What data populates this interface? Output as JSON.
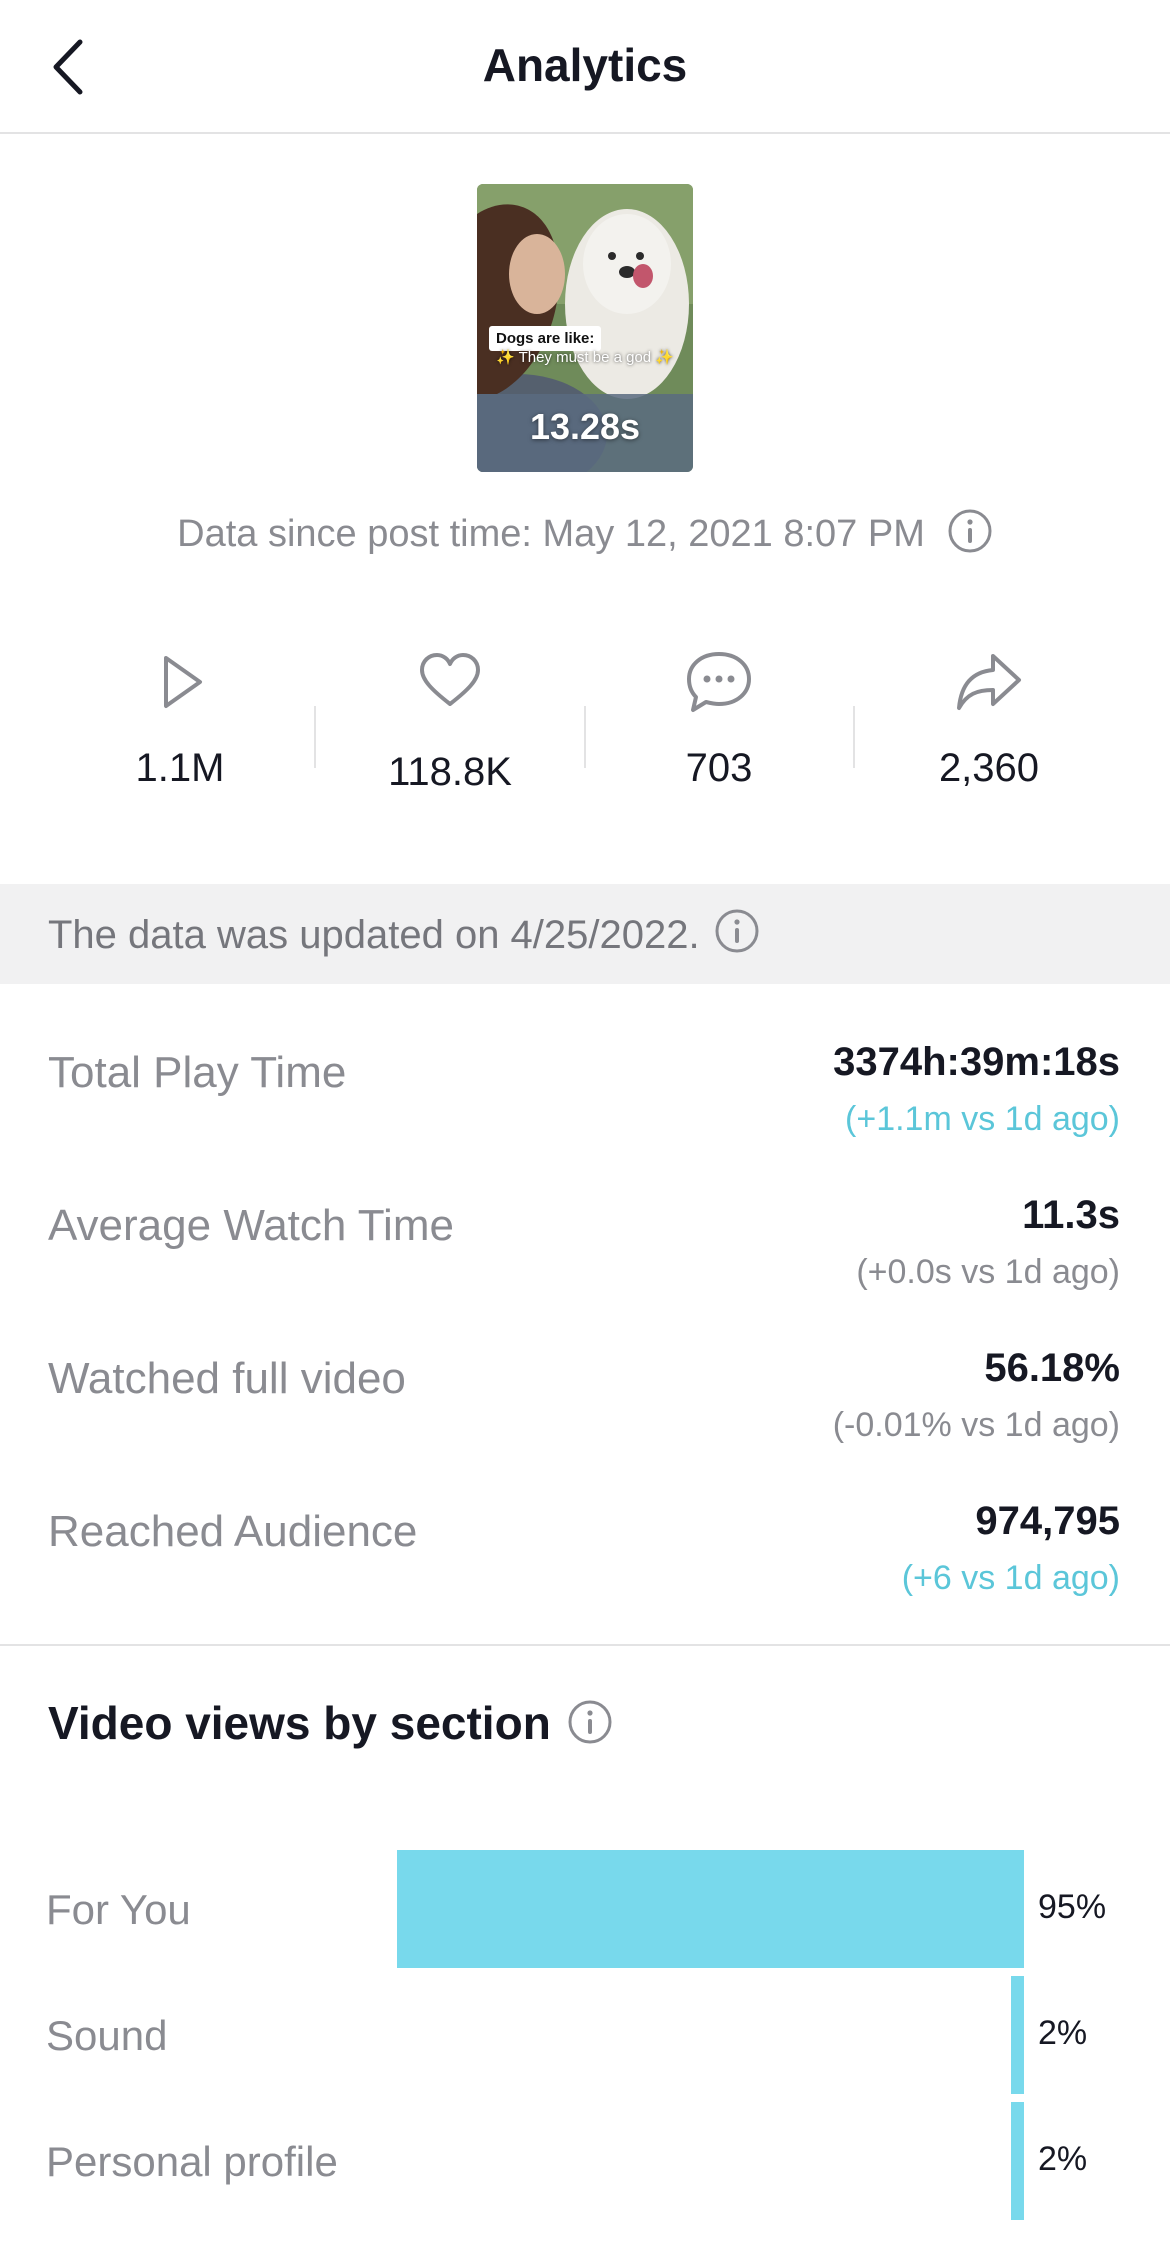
{
  "header": {
    "title": "Analytics"
  },
  "video": {
    "caption_line1": "Dogs are like:",
    "caption_line2": "✨ They must be a god ✨",
    "duration": "13.28s"
  },
  "since": {
    "text": "Data since post time: May 12, 2021 8:07 PM"
  },
  "stats": {
    "views": "1.1M",
    "likes": "118.8K",
    "comments": "703",
    "shares": "2,360"
  },
  "updated": {
    "text": "The data was updated on 4/25/2022."
  },
  "metrics": [
    {
      "label": "Total Play Time",
      "value": "3374h:39m:18s",
      "delta": "(+1.1m vs 1d ago)"
    },
    {
      "label": "Average Watch Time",
      "value": "11.3s",
      "delta": "(+0.0s vs 1d ago)"
    },
    {
      "label": "Watched full video",
      "value": "56.18%",
      "delta": "(-0.01% vs 1d ago)"
    },
    {
      "label": "Reached Audience",
      "value": "974,795",
      "delta": "(+6 vs 1d ago)"
    }
  ],
  "views_by_section": {
    "title": "Video views by section",
    "rows": [
      {
        "label": "For You",
        "pct_text": "95%",
        "value": 95
      },
      {
        "label": "Sound",
        "pct_text": "2%",
        "value": 2
      },
      {
        "label": "Personal profile",
        "pct_text": "2%",
        "value": 2
      }
    ]
  },
  "colors": {
    "accent": "#78d9ec",
    "positive_delta": "#5bc6d9",
    "muted_text": "#8a8b91"
  },
  "icons": [
    "back-arrow-icon",
    "info-icon",
    "play-icon",
    "heart-icon",
    "comment-icon",
    "share-icon"
  ]
}
